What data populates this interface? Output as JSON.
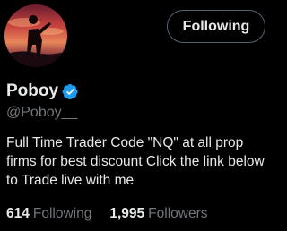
{
  "profile": {
    "display_name": "Poboy",
    "handle": "@Poboy__",
    "verified": true,
    "verified_icon": "verified-badge-icon",
    "avatar": "avatar-silhouette-sunset",
    "bio": "Full Time Trader Code \"NQ\" at all prop firms for best discount Click the link below to Trade live with me"
  },
  "follow_button": {
    "label": "Following"
  },
  "stats": {
    "following_count": "614",
    "following_label": "Following",
    "followers_count": "1,995",
    "followers_label": "Followers"
  },
  "colors": {
    "background": "#000000",
    "primary_text": "#e7e9ea",
    "secondary_text": "#71767b",
    "verified_badge": "#1d9bf0",
    "button_border": "#536471"
  }
}
